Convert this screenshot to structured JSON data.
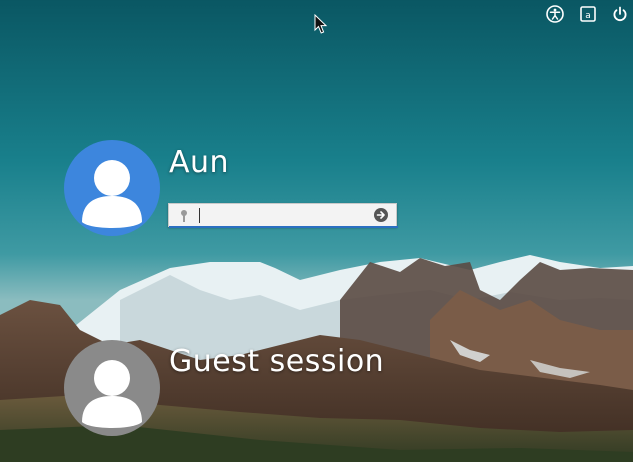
{
  "top_bar": {
    "icons": [
      "accessibility-icon",
      "keyboard-layout-icon",
      "power-icon"
    ]
  },
  "users": [
    {
      "name": "Aun",
      "avatar_color": "#3d86dd",
      "selected": true
    },
    {
      "name": "Guest session",
      "avatar_color": "#8a8a8a",
      "selected": false
    }
  ],
  "password_field": {
    "value": "",
    "placeholder": "",
    "focus_color": "#2b6fc2"
  },
  "colors": {
    "sky_top": "#0e5f6b",
    "text": "#ffffff"
  }
}
